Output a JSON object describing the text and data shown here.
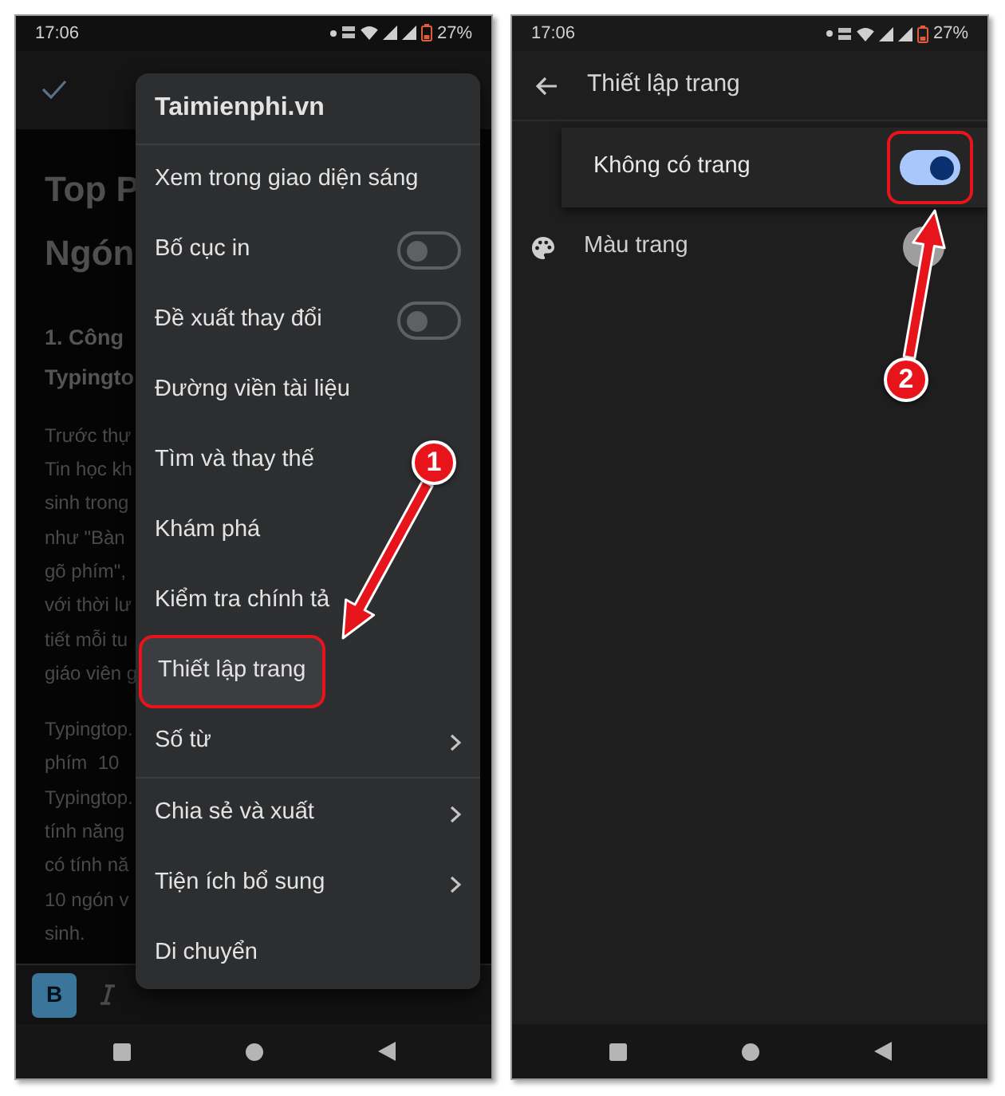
{
  "left_screen": {
    "status_bar": {
      "time": "17:06",
      "battery": "27%"
    },
    "document": {
      "blocks": [
        {
          "kind": "title",
          "lines": [
            "Top P",
            "Ngón"
          ]
        },
        {
          "kind": "heading",
          "lines": [
            "1. Công",
            "Typingto"
          ]
        },
        {
          "kind": "body",
          "lines": [
            "Trước thự",
            "Tin học kh",
            "sinh trong",
            "như \"Bàn",
            "gõ phím\",",
            "với thời lư",
            "tiết mỗi tu",
            "giáo viên g"
          ]
        },
        {
          "kind": "body",
          "lines": [
            "Typingtop.",
            "phím  10",
            "Typingtop.",
            "tính năng",
            "có tính nă",
            "10 ngón v",
            "sinh."
          ]
        }
      ]
    },
    "toolbar": {
      "buttons": [
        {
          "label": "B",
          "selected": true
        }
      ]
    },
    "menu": {
      "title": "Taimienphi.vn",
      "sections": [
        [
          {
            "kind": "plain",
            "label": "Xem trong giao diện sáng",
            "highlighted": false
          },
          {
            "kind": "toggle",
            "label": "Bố cục in",
            "on": false,
            "highlighted": false
          },
          {
            "kind": "toggle",
            "label": "Đề xuất thay đổi",
            "on": false,
            "highlighted": false
          },
          {
            "kind": "plain",
            "label": "Đường viền tài liệu",
            "highlighted": false
          },
          {
            "kind": "plain",
            "label": "Tìm và thay thế",
            "highlighted": false
          },
          {
            "kind": "plain",
            "label": "Khám phá",
            "highlighted": false
          },
          {
            "kind": "plain",
            "label": "Kiểm tra chính tả",
            "highlighted": false
          },
          {
            "kind": "plain",
            "label": "Thiết lập trang",
            "highlighted": true
          },
          {
            "kind": "submenu",
            "label": "Số từ",
            "highlighted": false
          }
        ],
        [
          {
            "kind": "submenu",
            "label": "Chia sẻ và xuất",
            "highlighted": false
          },
          {
            "kind": "submenu",
            "label": "Tiện ích bổ sung",
            "highlighted": false
          },
          {
            "kind": "plain",
            "label": "Di chuyển",
            "highlighted": false
          }
        ]
      ]
    },
    "step_badge": "1"
  },
  "right_screen": {
    "status_bar": {
      "time": "17:06",
      "battery": "27%"
    },
    "title": "Thiết lập trang",
    "settings": [
      {
        "kind": "toggle",
        "label": "Không có trang",
        "on": true,
        "highlighted": true
      },
      {
        "kind": "color",
        "label": "Màu trang",
        "color": "#9e9e9e"
      }
    ],
    "step_badge": "2"
  }
}
